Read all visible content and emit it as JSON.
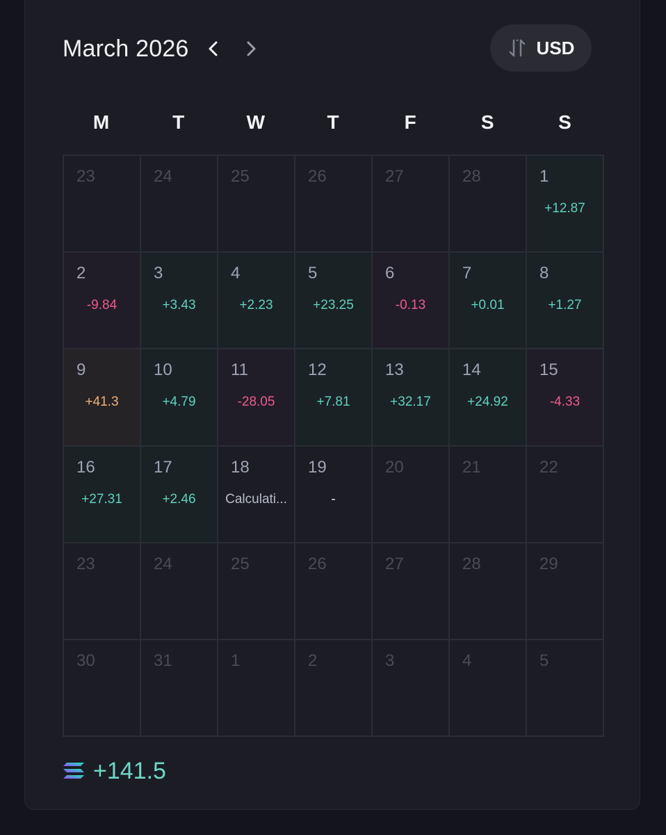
{
  "header": {
    "title": "March 2026",
    "prev_icon": "chevron-left-icon",
    "next_icon": "chevron-right-icon"
  },
  "currency": {
    "label": "USD",
    "icon": "swap-vertical-icon"
  },
  "weekdays": [
    "M",
    "T",
    "W",
    "T",
    "F",
    "S",
    "S"
  ],
  "days": [
    {
      "day": "23",
      "outside": true
    },
    {
      "day": "24",
      "outside": true
    },
    {
      "day": "25",
      "outside": true
    },
    {
      "day": "26",
      "outside": true
    },
    {
      "day": "27",
      "outside": true
    },
    {
      "day": "28",
      "outside": true
    },
    {
      "day": "1",
      "pnl": "+12.87",
      "tone": "pos"
    },
    {
      "day": "2",
      "pnl": "-9.84",
      "tone": "neg"
    },
    {
      "day": "3",
      "pnl": "+3.43",
      "tone": "pos"
    },
    {
      "day": "4",
      "pnl": "+2.23",
      "tone": "pos"
    },
    {
      "day": "5",
      "pnl": "+23.25",
      "tone": "pos"
    },
    {
      "day": "6",
      "pnl": "-0.13",
      "tone": "neg"
    },
    {
      "day": "7",
      "pnl": "+0.01",
      "tone": "pos"
    },
    {
      "day": "8",
      "pnl": "+1.27",
      "tone": "pos"
    },
    {
      "day": "9",
      "pnl": "+41.3",
      "tone": "warn"
    },
    {
      "day": "10",
      "pnl": "+4.79",
      "tone": "pos"
    },
    {
      "day": "11",
      "pnl": "-28.05",
      "tone": "neg"
    },
    {
      "day": "12",
      "pnl": "+7.81",
      "tone": "pos"
    },
    {
      "day": "13",
      "pnl": "+32.17",
      "tone": "pos"
    },
    {
      "day": "14",
      "pnl": "+24.92",
      "tone": "pos"
    },
    {
      "day": "15",
      "pnl": "-4.33",
      "tone": "neg"
    },
    {
      "day": "16",
      "pnl": "+27.31",
      "tone": "pos"
    },
    {
      "day": "17",
      "pnl": "+2.46",
      "tone": "pos"
    },
    {
      "day": "18",
      "pnl": "Calculati...",
      "tone": "pending"
    },
    {
      "day": "19",
      "pnl": "-",
      "tone": "none"
    },
    {
      "day": "20",
      "outside": true
    },
    {
      "day": "21",
      "outside": true
    },
    {
      "day": "22",
      "outside": true
    },
    {
      "day": "23",
      "outside": true
    },
    {
      "day": "24",
      "outside": true
    },
    {
      "day": "25",
      "outside": true
    },
    {
      "day": "26",
      "outside": true
    },
    {
      "day": "27",
      "outside": true
    },
    {
      "day": "28",
      "outside": true
    },
    {
      "day": "29",
      "outside": true
    },
    {
      "day": "30",
      "outside": true
    },
    {
      "day": "31",
      "outside": true
    },
    {
      "day": "1",
      "outside": true
    },
    {
      "day": "2",
      "outside": true
    },
    {
      "day": "3",
      "outside": true
    },
    {
      "day": "4",
      "outside": true
    },
    {
      "day": "5",
      "outside": true
    }
  ],
  "total": {
    "icon": "solana-logo-icon",
    "value": "+141.5"
  },
  "colors": {
    "positive": "#5ed2bd",
    "negative": "#ee5b8a",
    "warning": "#f0b077",
    "background": "#1b1c24"
  }
}
